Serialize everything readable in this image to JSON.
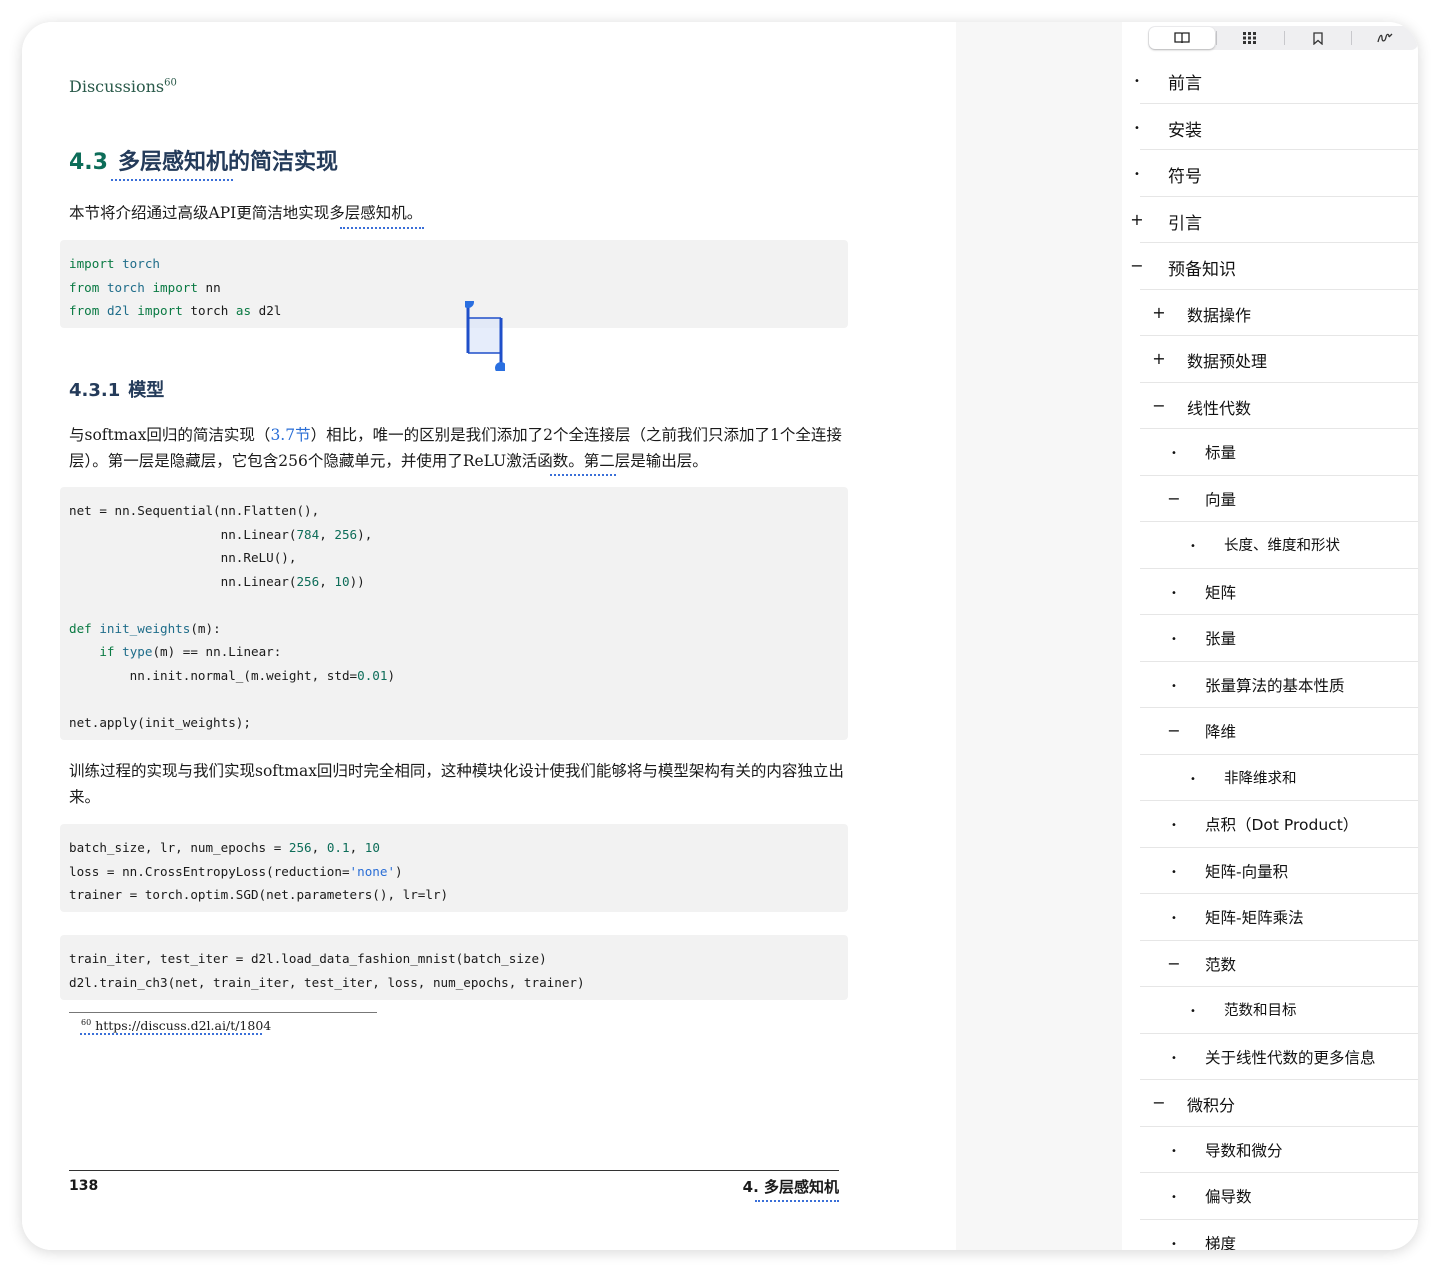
{
  "page": {
    "discussions": "Discussions",
    "discussions_ref": "60",
    "section": {
      "number": "4.3",
      "title": "多层感知机的简洁实现"
    },
    "intro": "本节将介绍通过高级API更简洁地实现多层感知机。",
    "code1": {
      "lines": [
        [
          {
            "t": "import",
            "c": "kw"
          },
          {
            "t": " "
          },
          {
            "t": "torch",
            "c": "nm"
          }
        ],
        [
          {
            "t": "from",
            "c": "kw"
          },
          {
            "t": " "
          },
          {
            "t": "torch",
            "c": "nm"
          },
          {
            "t": " "
          },
          {
            "t": "import",
            "c": "kw"
          },
          {
            "t": " nn"
          }
        ],
        [
          {
            "t": "from",
            "c": "kw"
          },
          {
            "t": " "
          },
          {
            "t": "d2l",
            "c": "nm"
          },
          {
            "t": " "
          },
          {
            "t": "import",
            "c": "kw"
          },
          {
            "t": " torch "
          },
          {
            "t": "as",
            "c": "kw"
          },
          {
            "t": " d2l"
          }
        ]
      ]
    },
    "subsection": {
      "number": "4.3.1",
      "title": "模型"
    },
    "para_model": {
      "before": "与softmax回归的简洁实现（",
      "link": "3.7节",
      "after": "）相比，唯一的区别是我们添加了2个全连接层（之前我们只添加了1个全连接层）。第一层是隐藏层，它包含256个隐藏单元，并使用了ReLU激活函数。第二层是输出层。"
    },
    "code2": {
      "lines": [
        [
          {
            "t": "net = nn.Sequential(nn.Flatten(),"
          }
        ],
        [
          {
            "t": "                    nn.Linear("
          },
          {
            "t": "784",
            "c": "num"
          },
          {
            "t": ", "
          },
          {
            "t": "256",
            "c": "num"
          },
          {
            "t": "),"
          }
        ],
        [
          {
            "t": "                    nn.ReLU(),"
          }
        ],
        [
          {
            "t": "                    nn.Linear("
          },
          {
            "t": "256",
            "c": "num"
          },
          {
            "t": ", "
          },
          {
            "t": "10",
            "c": "num"
          },
          {
            "t": "))"
          }
        ],
        [
          {
            "t": ""
          }
        ],
        [
          {
            "t": "def",
            "c": "kw"
          },
          {
            "t": " "
          },
          {
            "t": "init_weights",
            "c": "nm"
          },
          {
            "t": "(m):"
          }
        ],
        [
          {
            "t": "    "
          },
          {
            "t": "if",
            "c": "kw"
          },
          {
            "t": " "
          },
          {
            "t": "type",
            "c": "nm"
          },
          {
            "t": "(m) == nn.Linear:"
          }
        ],
        [
          {
            "t": "        nn.init.normal_(m.weight, std="
          },
          {
            "t": "0.01",
            "c": "num"
          },
          {
            "t": ")"
          }
        ],
        [
          {
            "t": ""
          }
        ],
        [
          {
            "t": "net.apply(init_weights);"
          }
        ]
      ]
    },
    "para_train": "训练过程的实现与我们实现softmax回归时完全相同，这种模块化设计使我们能够将与模型架构有关的内容独立出来。",
    "code3": {
      "lines": [
        [
          {
            "t": "batch_size, lr, num_epochs = "
          },
          {
            "t": "256",
            "c": "num"
          },
          {
            "t": ", "
          },
          {
            "t": "0.1",
            "c": "num"
          },
          {
            "t": ", "
          },
          {
            "t": "10",
            "c": "num"
          }
        ],
        [
          {
            "t": "loss = nn.CrossEntropyLoss(reduction="
          },
          {
            "t": "'none'",
            "c": "str"
          },
          {
            "t": ")"
          }
        ],
        [
          {
            "t": "trainer = torch.optim.SGD(net.parameters(), lr=lr)"
          }
        ]
      ]
    },
    "code4": {
      "lines": [
        [
          {
            "t": "train_iter, test_iter = d2l.load_data_fashion_mnist(batch_size)"
          }
        ],
        [
          {
            "t": "d2l.train_ch3(net, train_iter, test_iter, loss, num_epochs, trainer)"
          }
        ]
      ]
    },
    "footnote": {
      "num": "60",
      "url": "https://discuss.d2l.ai/t/1804"
    },
    "footer": {
      "page_number": "138",
      "chapter": "4.  多层感知机"
    }
  },
  "sidebar": {
    "tabs": [
      {
        "name": "book-icon"
      },
      {
        "name": "grid-icon"
      },
      {
        "name": "bookmark-icon"
      },
      {
        "name": "annotation-icon"
      }
    ],
    "toc": [
      {
        "label": "前言",
        "level": 0,
        "marker": "•"
      },
      {
        "label": "安装",
        "level": 0,
        "marker": "•"
      },
      {
        "label": "符号",
        "level": 0,
        "marker": "•"
      },
      {
        "label": "引言",
        "level": 0,
        "marker": "+"
      },
      {
        "label": "预备知识",
        "level": 0,
        "marker": "−"
      },
      {
        "label": "数据操作",
        "level": 1,
        "marker": "+"
      },
      {
        "label": "数据预处理",
        "level": 1,
        "marker": "+"
      },
      {
        "label": "线性代数",
        "level": 1,
        "marker": "−"
      },
      {
        "label": "标量",
        "level": 2,
        "marker": "•"
      },
      {
        "label": "向量",
        "level": 2,
        "marker": "−"
      },
      {
        "label": "长度、维度和形状",
        "level": 3,
        "marker": "•"
      },
      {
        "label": "矩阵",
        "level": 2,
        "marker": "•"
      },
      {
        "label": "张量",
        "level": 2,
        "marker": "•"
      },
      {
        "label": "张量算法的基本性质",
        "level": 2,
        "marker": "•"
      },
      {
        "label": "降维",
        "level": 2,
        "marker": "−"
      },
      {
        "label": "非降维求和",
        "level": 3,
        "marker": "•"
      },
      {
        "label": "点积（Dot Product）",
        "level": 2,
        "marker": "•"
      },
      {
        "label": "矩阵-向量积",
        "level": 2,
        "marker": "•"
      },
      {
        "label": "矩阵-矩阵乘法",
        "level": 2,
        "marker": "•"
      },
      {
        "label": "范数",
        "level": 2,
        "marker": "−"
      },
      {
        "label": "范数和目标",
        "level": 3,
        "marker": "•"
      },
      {
        "label": "关于线性代数的更多信息",
        "level": 2,
        "marker": "•"
      },
      {
        "label": "微积分",
        "level": 1,
        "marker": "−"
      },
      {
        "label": "导数和微分",
        "level": 2,
        "marker": "•"
      },
      {
        "label": "偏导数",
        "level": 2,
        "marker": "•"
      },
      {
        "label": "梯度",
        "level": 2,
        "marker": "•"
      }
    ]
  }
}
